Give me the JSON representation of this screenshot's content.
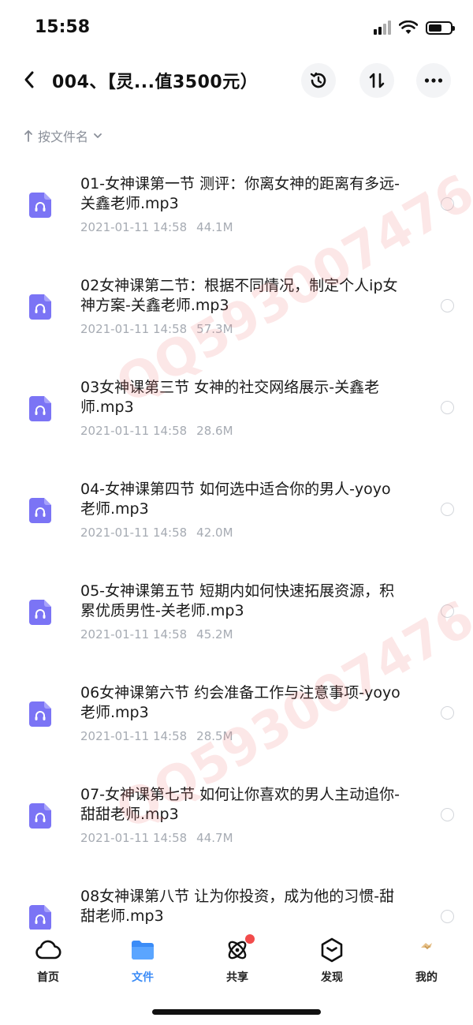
{
  "status_bar": {
    "time": "15:58"
  },
  "header": {
    "title": "004、【灵...值3500元）"
  },
  "sort": {
    "label": "按文件名"
  },
  "watermark": {
    "text": "QQ593007476"
  },
  "files": [
    {
      "name": "01-女神课第一节 测评：你离女神的距离有多远-关鑫老师.mp3",
      "date": "2021-01-11 14:58",
      "size": "44.1M"
    },
    {
      "name": "02女神课第二节：根据不同情况，制定个人ip女神方案-关鑫老师.mp3",
      "date": "2021-01-11 14:58",
      "size": "57.3M"
    },
    {
      "name": "03女神课第三节 女神的社交网络展示-关鑫老师.mp3",
      "date": "2021-01-11 14:58",
      "size": "28.6M"
    },
    {
      "name": "04-女神课第四节 如何选中适合你的男人-yoyo老师.mp3",
      "date": "2021-01-11 14:58",
      "size": "42.0M"
    },
    {
      "name": "05-女神课第五节 短期内如何快速拓展资源，积累优质男性-关老师.mp3",
      "date": "2021-01-11 14:58",
      "size": "45.2M"
    },
    {
      "name": "06女神课第六节 约会准备工作与注意事项-yoyo老师.mp3",
      "date": "2021-01-11 14:58",
      "size": "28.5M"
    },
    {
      "name": "07-女神课第七节 如何让你喜欢的男人主动追你-甜甜老师.mp3",
      "date": "2021-01-11 14:58",
      "size": "44.7M"
    },
    {
      "name": "08女神课第八节 让为你投资，成为他的习惯-甜甜老师.mp3",
      "date": "",
      "size": ""
    }
  ],
  "tabs": [
    {
      "label": "首页"
    },
    {
      "label": "文件"
    },
    {
      "label": "共享"
    },
    {
      "label": "发现"
    },
    {
      "label": "我的"
    }
  ],
  "colors": {
    "accent": "#3b8cf7",
    "file_icon": "#7b74f5",
    "badge": "#f24b4b"
  }
}
